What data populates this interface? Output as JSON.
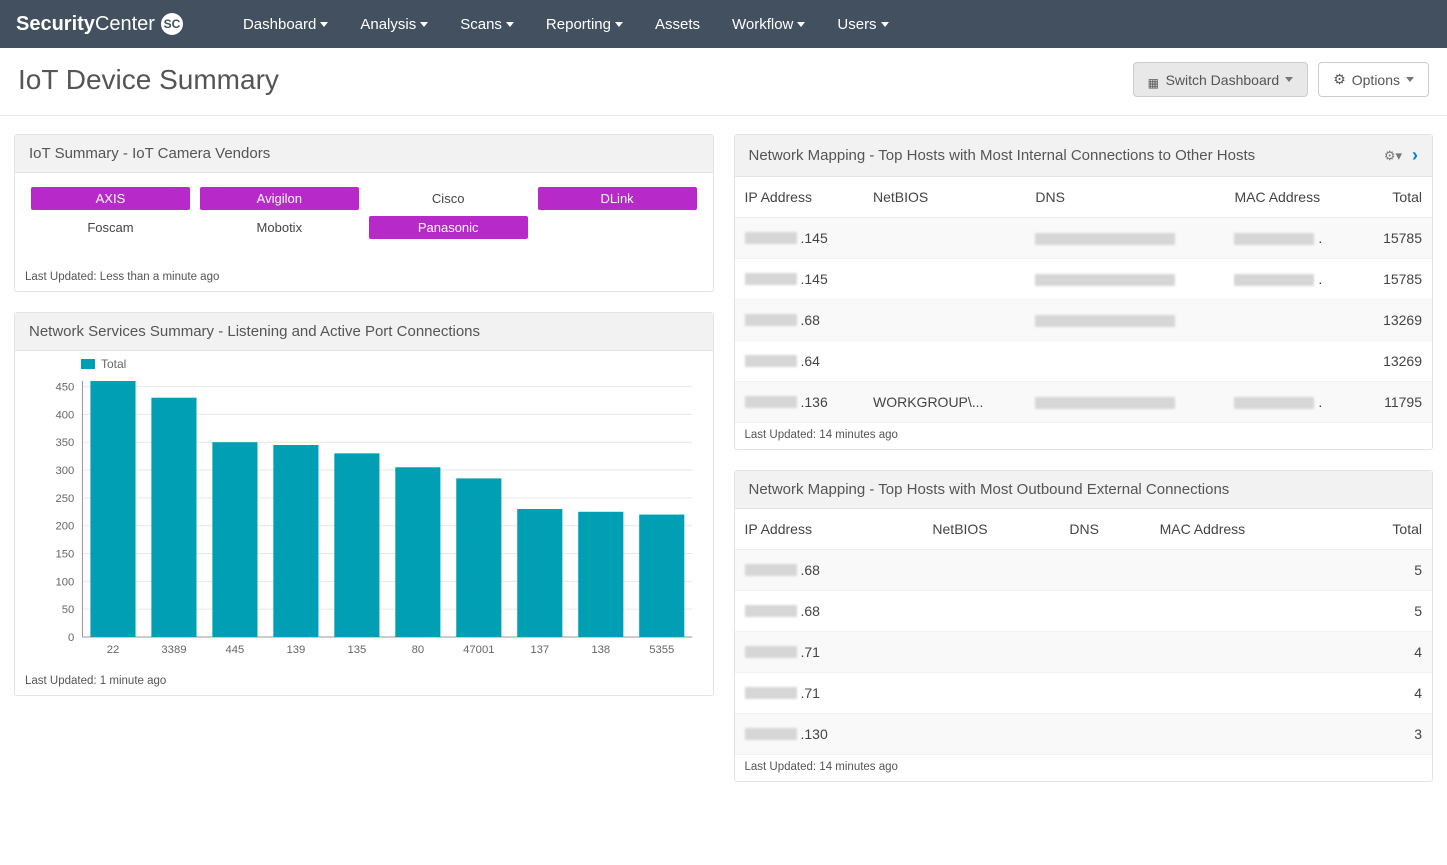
{
  "brand": {
    "name1": "Security",
    "name2": "Center",
    "badge": "SC"
  },
  "nav": [
    {
      "label": "Dashboard",
      "caret": true
    },
    {
      "label": "Analysis",
      "caret": true
    },
    {
      "label": "Scans",
      "caret": true
    },
    {
      "label": "Reporting",
      "caret": true
    },
    {
      "label": "Assets",
      "caret": false
    },
    {
      "label": "Workflow",
      "caret": true
    },
    {
      "label": "Users",
      "caret": true
    }
  ],
  "page_title": "IoT Device Summary",
  "header_buttons": {
    "switch": "Switch Dashboard",
    "options": "Options"
  },
  "vendors_panel": {
    "title": "IoT Summary - IoT Camera Vendors",
    "footer": "Last Updated: Less than a minute ago",
    "cells": [
      {
        "label": "AXIS",
        "on": true
      },
      {
        "label": "Avigilon",
        "on": true
      },
      {
        "label": "Cisco",
        "on": false
      },
      {
        "label": "DLink",
        "on": true
      },
      {
        "label": "Foscam",
        "on": false
      },
      {
        "label": "Mobotix",
        "on": false
      },
      {
        "label": "Panasonic",
        "on": true
      },
      {
        "label": "",
        "on": false
      }
    ]
  },
  "chart_panel": {
    "title": "Network Services Summary - Listening and Active Port Connections",
    "legend": "Total",
    "footer": "Last Updated: 1 minute ago"
  },
  "chart_data": {
    "type": "bar",
    "categories": [
      "22",
      "3389",
      "445",
      "139",
      "135",
      "80",
      "47001",
      "137",
      "138",
      "5355"
    ],
    "values": [
      460,
      430,
      350,
      345,
      330,
      305,
      285,
      230,
      225,
      220
    ],
    "series_name": "Total",
    "ylabel": "",
    "xlabel": "",
    "ylim": [
      0,
      460
    ],
    "yticks": [
      0,
      50,
      100,
      150,
      200,
      250,
      300,
      350,
      400,
      450
    ]
  },
  "internal_panel": {
    "title": "Network Mapping - Top Hosts with Most Internal Connections to Other Hosts",
    "footer": "Last Updated: 14 minutes ago",
    "cols": {
      "ip": "IP Address",
      "netbios": "NetBIOS",
      "dns": "DNS",
      "mac": "MAC Address",
      "total": "Total"
    },
    "rows": [
      {
        "ip_tail": "145",
        "netbios": "",
        "dns_blur": true,
        "mac_blur": true,
        "total": "15785"
      },
      {
        "ip_tail": "145",
        "netbios": "",
        "dns_blur": true,
        "mac_blur": true,
        "total": "15785"
      },
      {
        "ip_tail": "68",
        "netbios": "",
        "dns_blur": true,
        "mac_blur": false,
        "total": "13269"
      },
      {
        "ip_tail": "64",
        "netbios": "",
        "dns_blur": false,
        "mac_blur": false,
        "total": "13269"
      },
      {
        "ip_tail": "136",
        "netbios": "WORKGROUP\\...",
        "dns_blur": true,
        "mac_blur": true,
        "total": "11795"
      }
    ]
  },
  "outbound_panel": {
    "title": "Network Mapping - Top Hosts with Most Outbound External Connections",
    "footer": "Last Updated: 14 minutes ago",
    "cols": {
      "ip": "IP Address",
      "netbios": "NetBIOS",
      "dns": "DNS",
      "mac": "MAC Address",
      "total": "Total"
    },
    "rows": [
      {
        "ip_tail": "68",
        "total": "5"
      },
      {
        "ip_tail": "68",
        "total": "5"
      },
      {
        "ip_tail": "71",
        "total": "4"
      },
      {
        "ip_tail": "71",
        "total": "4"
      },
      {
        "ip_tail": "130",
        "total": "3"
      }
    ]
  }
}
